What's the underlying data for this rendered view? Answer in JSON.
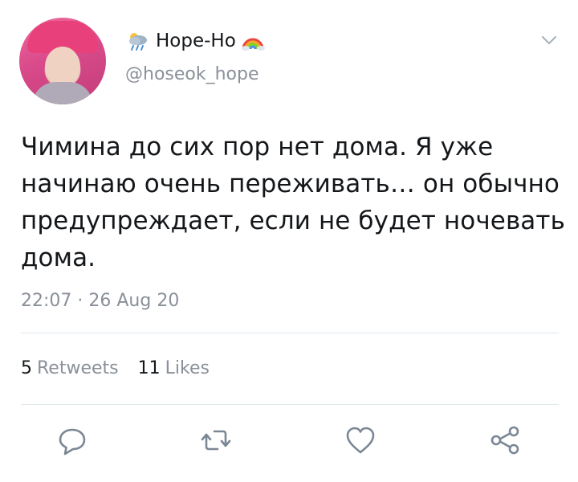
{
  "tweet": {
    "display_name": "Hope-Ho",
    "handle": "@hoseok_hope",
    "text": "Чимина до сих пор нет дома. Я уже начинаю очень переживать… он обычно предупреждает, если не будет ночевать дома.",
    "timestamp": "22:07 · 26 Aug 20",
    "retweets_count": "5",
    "retweets_label": "Retweets",
    "likes_count": "11",
    "likes_label": "Likes"
  },
  "icons": {
    "name_prefix": "weather-rain-cloud-icon",
    "name_suffix": "rainbow-icon",
    "menu": "chevron-down-icon",
    "actions": [
      "reply-icon",
      "retweet-icon",
      "like-icon",
      "share-icon"
    ]
  },
  "colors": {
    "text": "#14171a",
    "secondary": "#8a9099",
    "divider": "#e1e8ed",
    "icon": "#7b8794"
  }
}
